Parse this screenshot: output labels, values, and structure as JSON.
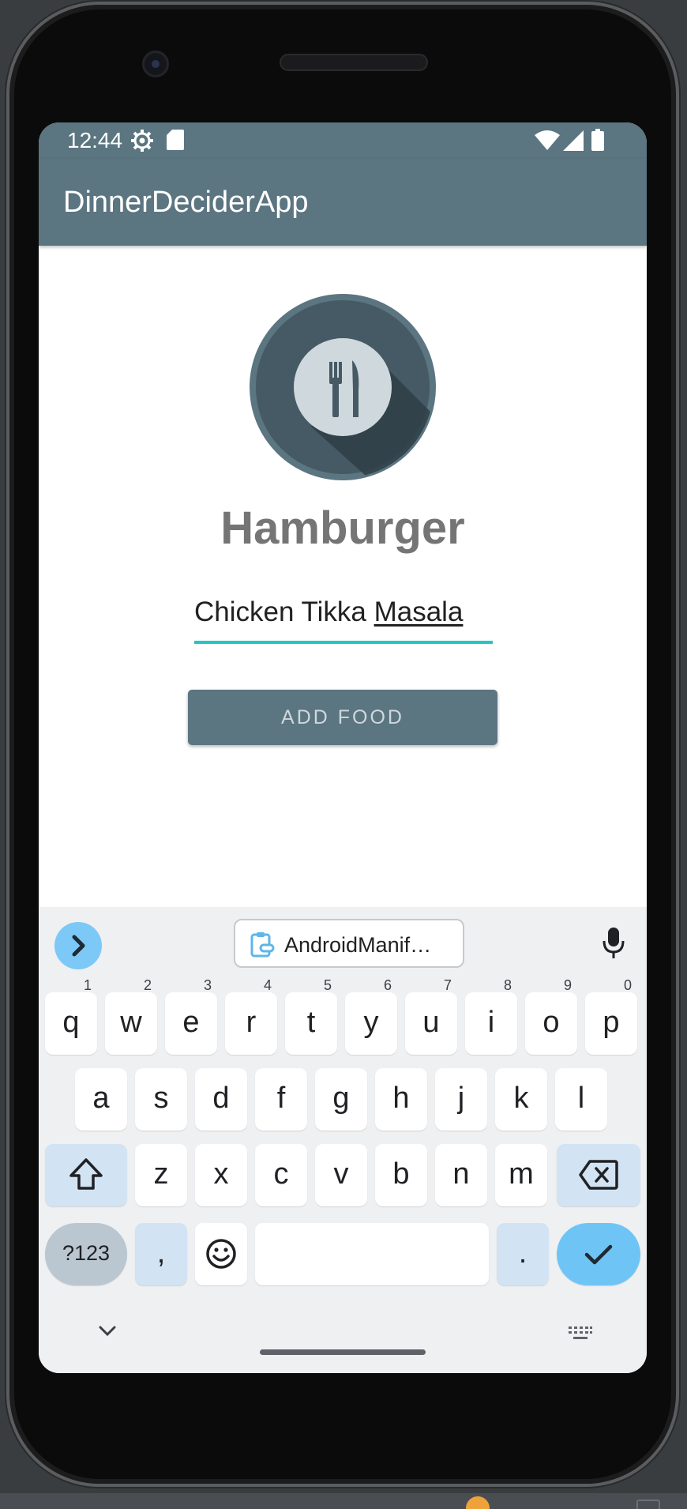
{
  "status_bar": {
    "time": "12:44",
    "icons": [
      "settings-gear-icon",
      "sd-card-icon",
      "wifi-icon",
      "signal-icon",
      "battery-icon"
    ]
  },
  "app_bar": {
    "title": "DinnerDeciderApp"
  },
  "main": {
    "logo_icon": "fork-knife-plate-icon",
    "decided_food": "Hamburger",
    "food_input": {
      "committed_text": "Chicken Tikka ",
      "composing_text": "Masala"
    },
    "add_button_label": "ADD FOOD"
  },
  "keyboard": {
    "clipboard_suggestion": "AndroidManif…",
    "row1": [
      {
        "key": "q",
        "hint": "1"
      },
      {
        "key": "w",
        "hint": "2"
      },
      {
        "key": "e",
        "hint": "3"
      },
      {
        "key": "r",
        "hint": "4"
      },
      {
        "key": "t",
        "hint": "5"
      },
      {
        "key": "y",
        "hint": "6"
      },
      {
        "key": "u",
        "hint": "7"
      },
      {
        "key": "i",
        "hint": "8"
      },
      {
        "key": "o",
        "hint": "9"
      },
      {
        "key": "p",
        "hint": "0"
      }
    ],
    "row2": [
      "a",
      "s",
      "d",
      "f",
      "g",
      "h",
      "j",
      "k",
      "l"
    ],
    "row3": [
      "z",
      "x",
      "c",
      "v",
      "b",
      "n",
      "m"
    ],
    "symbols_label": "?123",
    "comma_label": ",",
    "period_label": ".",
    "colors": {
      "accent": "#6ec5f5",
      "special_key": "#d2e3f3",
      "app_primary": "#5b7581",
      "input_underline": "#26c6c0"
    }
  }
}
